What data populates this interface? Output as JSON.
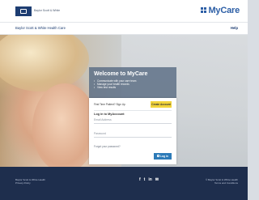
{
  "header": {
    "logo_text": "Baylor Scott & White",
    "brand": "MyCare"
  },
  "subnav": {
    "org": "Baylor Scott & White Health Care",
    "help": "Help"
  },
  "welcome": {
    "title": "Welcome to MyCare",
    "bullets": [
      "Communicate with your care team",
      "Manage your health records",
      "View test results"
    ]
  },
  "signup": {
    "first_time_text": "First Time Patient? Sign Up",
    "create_account_label": "Create Account"
  },
  "login": {
    "title": "Log in to MyAccount",
    "email_placeholder": "Email Address",
    "password_placeholder": "Password",
    "forgot_text": "Forgot your password?",
    "button_label": "Log in"
  },
  "footer": {
    "left_line1": "Baylor Scott & White Health",
    "left_line2": "Privacy Policy",
    "social_icons": [
      "facebook-icon",
      "twitter-icon",
      "linkedin-icon",
      "email-icon"
    ],
    "social_glyphs": [
      "f",
      "t",
      "in",
      "✉"
    ],
    "right_line1": "© Baylor Scott & White Health",
    "right_line2": "Terms and Conditions"
  }
}
